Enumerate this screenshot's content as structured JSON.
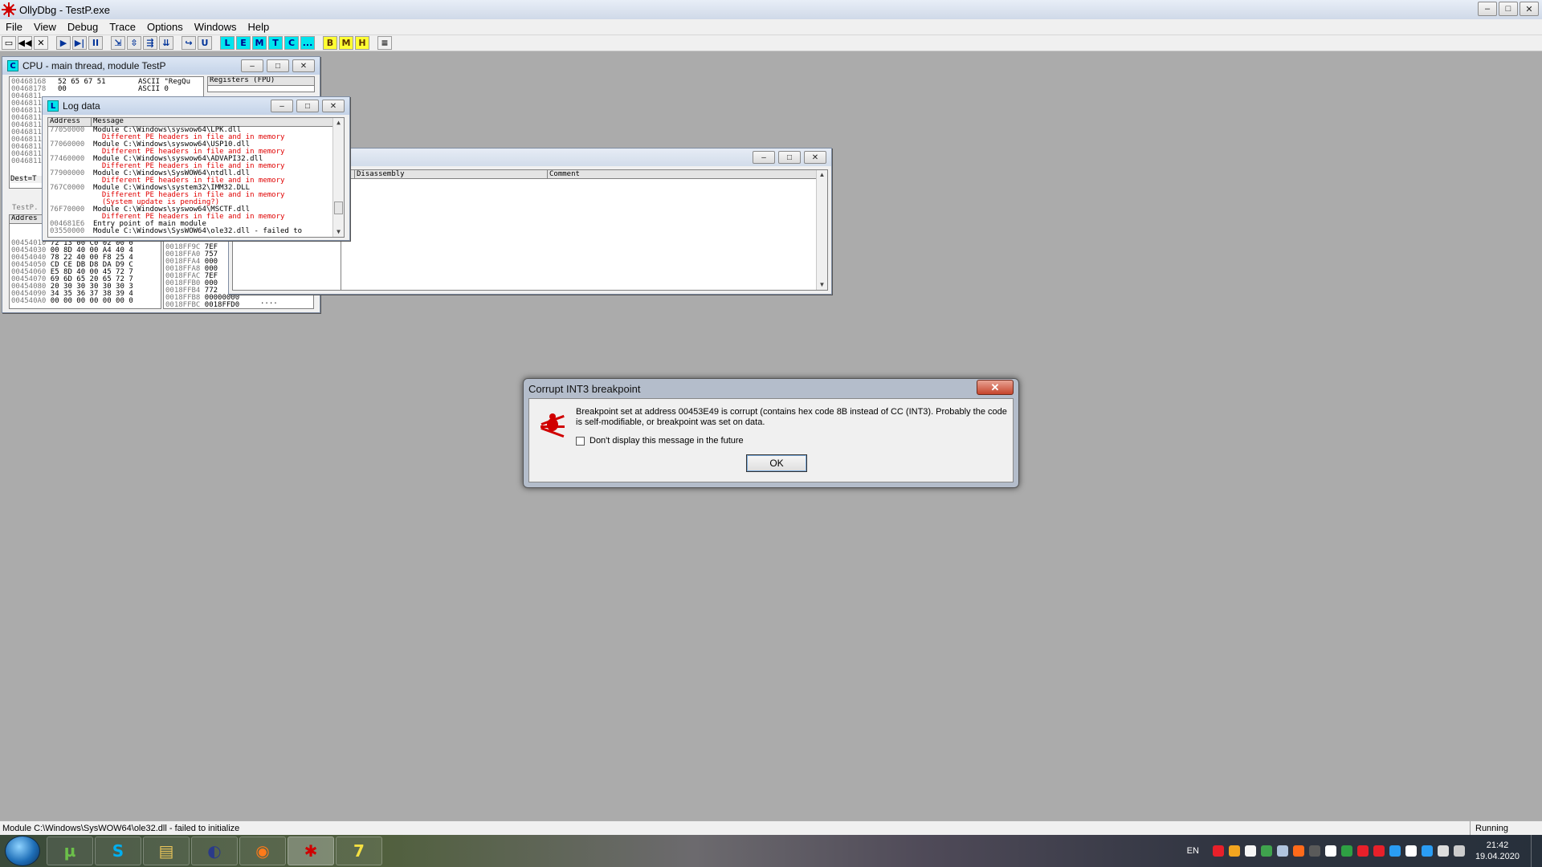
{
  "app": {
    "title": "OllyDbg - TestP.exe",
    "window_controls": {
      "minimize": "–",
      "maximize": "□",
      "close": "✕"
    }
  },
  "menu": [
    "File",
    "View",
    "Debug",
    "Trace",
    "Options",
    "Windows",
    "Help"
  ],
  "toolbar": {
    "file_buttons": [
      "▭",
      "◀◀",
      "✕"
    ],
    "run_buttons": [
      "▶",
      "▶|",
      "II"
    ],
    "step_buttons": [
      "⇲",
      "⇳",
      "⇶",
      "⇊",
      "↪",
      "U"
    ],
    "window_buttons": [
      "L",
      "E",
      "M",
      "T",
      "C",
      "..."
    ],
    "extra_buttons": [
      "B",
      "M",
      "H"
    ],
    "list_button": "≡"
  },
  "cpu_window": {
    "title": "CPU - main thread, module TestP",
    "icon_letter": "C",
    "disasm_lines": [
      "00468168",
      "00468178",
      "0046811",
      "0046811",
      "0046811",
      "0046811",
      "0046811",
      "0046811",
      "0046811",
      "0046811",
      "0046811",
      "0046811"
    ],
    "dump_top": [
      [
        "52 65 67 51",
        "ASCII \"RegQu"
      ],
      [
        "00",
        "ASCII 0"
      ]
    ],
    "registers_header": "Registers (FPU)",
    "info_label": "Dest=T",
    "info_label2": "TestP.",
    "dump_header": "Addres",
    "dump_rows": [
      [
        "00454010",
        "72 13 00 C0 02 00 0"
      ],
      [
        "00454030",
        "00 8D 40 00 A4 40 4"
      ],
      [
        "00454040",
        "78 22 40 00 F8 25 4"
      ],
      [
        "00454050",
        "CD CE DB D8 DA D9 C"
      ],
      [
        "00454060",
        "E5 8D 40 00 45 72 7"
      ],
      [
        "00454070",
        "69 6D 65 20 65 72 7"
      ],
      [
        "00454080",
        "20 30 30 30 30 30 3"
      ],
      [
        "00454090",
        "34 35 36 37 38 39 4"
      ],
      [
        "004540A0",
        "00 00 00 00 00 00 0"
      ]
    ],
    "stack_rows": [
      [
        "0018FF9C",
        "7EF"
      ],
      [
        "0018FFA0",
        "757"
      ],
      [
        "0018FFA4",
        "000"
      ],
      [
        "0018FFA8",
        "000"
      ],
      [
        "0018FFAC",
        "7EF"
      ],
      [
        "0018FFB0",
        "000"
      ],
      [
        "0018FFB4",
        "772"
      ],
      [
        "0018FFB8",
        "00000000"
      ],
      [
        "0018FFBC",
        "0018FFD0"
      ]
    ],
    "stack_note": "...."
  },
  "log_window": {
    "title": "Log data",
    "icon_letter": "L",
    "columns": [
      "Address",
      "Message"
    ],
    "rows": [
      {
        "addr": "77050000",
        "msg": "Module C:\\Windows\\syswow64\\LPK.dll",
        "warn": false
      },
      {
        "addr": "",
        "msg": "  Different PE headers in file and in memory",
        "warn": true
      },
      {
        "addr": "77060000",
        "msg": "Module C:\\Windows\\syswow64\\USP10.dll",
        "warn": false
      },
      {
        "addr": "",
        "msg": "  Different PE headers in file and in memory",
        "warn": true
      },
      {
        "addr": "77460000",
        "msg": "Module C:\\Windows\\syswow64\\ADVAPI32.dll",
        "warn": false
      },
      {
        "addr": "",
        "msg": "  Different PE headers in file and in memory",
        "warn": true
      },
      {
        "addr": "77900000",
        "msg": "Module C:\\Windows\\SysWOW64\\ntdll.dll",
        "warn": false
      },
      {
        "addr": "",
        "msg": "  Different PE headers in file and in memory",
        "warn": true
      },
      {
        "addr": "767C0000",
        "msg": "Module C:\\Windows\\system32\\IMM32.DLL",
        "warn": false
      },
      {
        "addr": "",
        "msg": "  Different PE headers in file and in memory",
        "warn": true
      },
      {
        "addr": "",
        "msg": "  (System update is pending?)",
        "warn": true
      },
      {
        "addr": "76F70000",
        "msg": "Module C:\\Windows\\syswow64\\MSCTF.dll",
        "warn": false
      },
      {
        "addr": "",
        "msg": "  Different PE headers in file and in memory",
        "warn": true
      },
      {
        "addr": "004681E6",
        "msg": "Entry point of main module",
        "warn": false
      },
      {
        "addr": "03550000",
        "msg": "Module C:\\Windows\\SysWOW64\\ole32.dll - failed to",
        "warn": false
      }
    ]
  },
  "disasm_window": {
    "columns": [
      "s",
      "Disassembly",
      "Comment"
    ]
  },
  "dialog": {
    "title": "Corrupt INT3 breakpoint",
    "close_label": "✕",
    "message": "Breakpoint set at address 00453E49 is corrupt (contains hex code 8B instead of CC (INT3). Probably the code is self-modifiable, or breakpoint was set on data.",
    "checkbox_label": "Don't display this message in the future",
    "ok_label": "OK"
  },
  "statusbar": {
    "message": "Module C:\\Windows\\SysWOW64\\ole32.dll - failed to initialize",
    "state": "Running"
  },
  "taskbar": {
    "apps": [
      {
        "name": "utorrent",
        "glyph": "µ",
        "color": "#6cc04a"
      },
      {
        "name": "skype",
        "glyph": "S",
        "color": "#00aff0"
      },
      {
        "name": "explorer",
        "glyph": "▤",
        "color": "#e8c35a"
      },
      {
        "name": "media",
        "glyph": "◐",
        "color": "#2a3a8a"
      },
      {
        "name": "firefox",
        "glyph": "◉",
        "color": "#ff7a1a"
      },
      {
        "name": "ollydbg",
        "glyph": "✱",
        "color": "#d00000"
      },
      {
        "name": "7zip",
        "glyph": "7",
        "color": "#f5e042"
      }
    ],
    "language": "EN",
    "time": "21:42",
    "date": "19.04.2020",
    "tray_colors": [
      "#e8202a",
      "#f2a51f",
      "#f5f5f5",
      "#3fa34d",
      "#b0c4de",
      "#ff6a1a",
      "#5a5a5a",
      "#ffffff",
      "#2ea043",
      "#e8202a",
      "#e8202a",
      "#2a9df4",
      "#ffffff",
      "#2a9df4",
      "#dddddd",
      "#cccccc"
    ]
  },
  "colors": {
    "desktop": "#ababab",
    "warn": "#e00000",
    "accent_cyan": "#00e5ee",
    "accent_yellow": "#ffff33"
  }
}
